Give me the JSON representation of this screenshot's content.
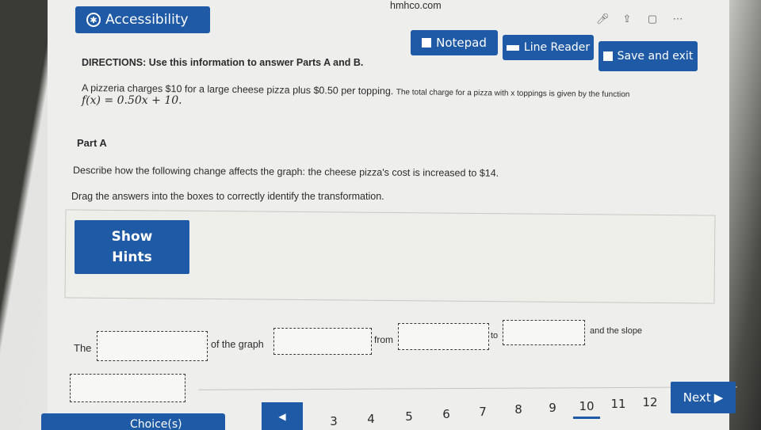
{
  "browser": {
    "url": "hmhco.com"
  },
  "toolbar": {
    "accessibility_label": "Accessibility",
    "notepad_label": "Notepad",
    "line_reader_label": "Line Reader",
    "save_exit_label": "Save and exit"
  },
  "question": {
    "directions": "DIRECTIONS: Use this information to answer Parts A and B.",
    "problem_part1": "A pizzeria charges $10 for a large cheese pizza plus $0.50 per topping. ",
    "problem_part2": "The total charge for a pizza with x toppings is given by the function",
    "function": "f(x) = 0.50x + 10.",
    "part_label": "Part A",
    "prompt": "Describe how the following change affects the graph: the cheese pizza's cost is increased to $14.",
    "instruction": "Drag the answers into the boxes to correctly identify the transformation."
  },
  "hints": {
    "line1": "Show",
    "line2": "Hints"
  },
  "answer_sentence": {
    "the": "The",
    "of_the_graph": "of the graph",
    "from": "from",
    "to": "to",
    "and_the_slope": "and the slope"
  },
  "choices": {
    "tab_label": "Choice(s)"
  },
  "pagination": {
    "pages": [
      "3",
      "4",
      "5",
      "6",
      "7",
      "8",
      "9",
      "10",
      "11",
      "12"
    ],
    "current": "10",
    "next_label": "Next"
  },
  "colors": {
    "accent": "#1f5aa6",
    "page_background": "#eeeeec"
  }
}
